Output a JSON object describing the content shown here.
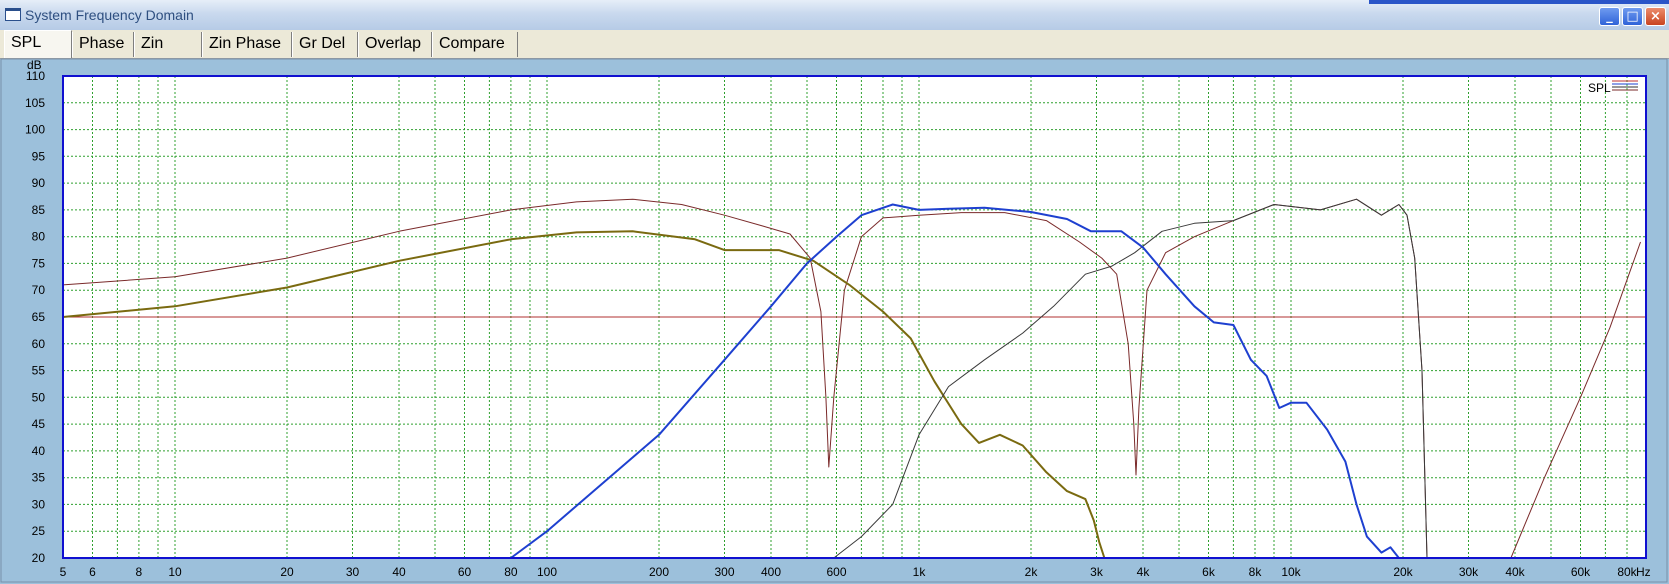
{
  "window": {
    "title": "System Frequency Domain",
    "min_icon": "minimize-icon",
    "max_icon": "maximize-icon",
    "close_icon": "close-icon"
  },
  "tabs": [
    {
      "label": "SPL",
      "active": true
    },
    {
      "label": "Phase",
      "active": false
    },
    {
      "label": "Zin",
      "active": false
    },
    {
      "label": "Zin Phase",
      "active": false
    },
    {
      "label": "Gr Del",
      "active": false
    },
    {
      "label": "Overlap",
      "active": false
    },
    {
      "label": "Compare",
      "active": false
    }
  ],
  "colors": {
    "plot_bg": "#ffffff",
    "frame": "#1010d0",
    "grid": "#2fa02f",
    "window_bg": "#9cc0db",
    "reference": "#c03030"
  },
  "chart_data": {
    "type": "line",
    "xscale": "log",
    "xlim": [
      5,
      90000
    ],
    "ylim": [
      20,
      110
    ],
    "ylabel": "dB",
    "xlabel": "Hz",
    "yticks": [
      20,
      25,
      30,
      35,
      40,
      45,
      50,
      55,
      60,
      65,
      70,
      75,
      80,
      85,
      90,
      95,
      100,
      105,
      110
    ],
    "xticks": [
      {
        "v": 5,
        "label": "5"
      },
      {
        "v": 6,
        "label": "6"
      },
      {
        "v": 8,
        "label": "8"
      },
      {
        "v": 10,
        "label": "10"
      },
      {
        "v": 20,
        "label": "20"
      },
      {
        "v": 30,
        "label": "30"
      },
      {
        "v": 40,
        "label": "40"
      },
      {
        "v": 60,
        "label": "60"
      },
      {
        "v": 80,
        "label": "80"
      },
      {
        "v": 100,
        "label": "100"
      },
      {
        "v": 200,
        "label": "200"
      },
      {
        "v": 300,
        "label": "300"
      },
      {
        "v": 400,
        "label": "400"
      },
      {
        "v": 600,
        "label": "600"
      },
      {
        "v": 1000,
        "label": "1k"
      },
      {
        "v": 2000,
        "label": "2k"
      },
      {
        "v": 3000,
        "label": "3k"
      },
      {
        "v": 4000,
        "label": "4k"
      },
      {
        "v": 6000,
        "label": "6k"
      },
      {
        "v": 8000,
        "label": "8k"
      },
      {
        "v": 10000,
        "label": "10k"
      },
      {
        "v": 20000,
        "label": "20k"
      },
      {
        "v": 30000,
        "label": "30k"
      },
      {
        "v": 40000,
        "label": "40k"
      },
      {
        "v": 60000,
        "label": "60k"
      },
      {
        "v": 80000,
        "label": "80k"
      }
    ],
    "grid": true,
    "legend": {
      "label": "SPL",
      "placement": "top-right",
      "colors": [
        "#c03030",
        "#1e40d0",
        "#303030",
        "#7a2a2a"
      ]
    },
    "series": [
      {
        "color": "#b03030",
        "width": 1,
        "points": [
          [
            5,
            65
          ],
          [
            90000,
            65
          ]
        ]
      },
      {
        "color": "#7a2a2a",
        "width": 1,
        "points": [
          [
            5,
            71
          ],
          [
            10,
            72.5
          ],
          [
            20,
            76
          ],
          [
            40,
            81
          ],
          [
            80,
            85
          ],
          [
            120,
            86.5
          ],
          [
            170,
            87
          ],
          [
            230,
            86
          ],
          [
            300,
            84
          ],
          [
            380,
            82
          ],
          [
            450,
            80.5
          ],
          [
            510,
            76
          ],
          [
            545,
            66
          ],
          [
            562,
            50
          ],
          [
            572,
            37
          ],
          [
            590,
            50
          ],
          [
            630,
            70
          ],
          [
            700,
            80
          ],
          [
            800,
            83.5
          ],
          [
            1000,
            84
          ],
          [
            1300,
            84.5
          ],
          [
            1700,
            84.5
          ],
          [
            2200,
            83
          ],
          [
            2700,
            79
          ],
          [
            3100,
            76
          ],
          [
            3400,
            73
          ],
          [
            3650,
            60
          ],
          [
            3780,
            45
          ],
          [
            3830,
            35.5
          ],
          [
            3900,
            48
          ],
          [
            4100,
            70
          ],
          [
            4600,
            77
          ],
          [
            5500,
            80
          ],
          [
            7000,
            83
          ],
          [
            9000,
            86
          ],
          [
            12000,
            85
          ],
          [
            15000,
            87
          ],
          [
            17500,
            84
          ],
          [
            19500,
            86
          ],
          [
            20500,
            84
          ],
          [
            21500,
            76
          ],
          [
            22500,
            55
          ],
          [
            23200,
            20
          ]
        ]
      },
      {
        "color": "#7a6a10",
        "width": 2,
        "points": [
          [
            5,
            65
          ],
          [
            10,
            67
          ],
          [
            20,
            70.5
          ],
          [
            40,
            75.5
          ],
          [
            80,
            79.5
          ],
          [
            120,
            80.8
          ],
          [
            170,
            81
          ],
          [
            250,
            79.5
          ],
          [
            300,
            77.5
          ],
          [
            420,
            77.5
          ],
          [
            520,
            75.5
          ],
          [
            650,
            71
          ],
          [
            800,
            66
          ],
          [
            950,
            61
          ],
          [
            1100,
            53
          ],
          [
            1300,
            45
          ],
          [
            1450,
            41.5
          ],
          [
            1650,
            43
          ],
          [
            1900,
            41
          ],
          [
            2200,
            36
          ],
          [
            2500,
            32.5
          ],
          [
            2800,
            31
          ],
          [
            2950,
            27
          ],
          [
            3050,
            23
          ],
          [
            3150,
            20
          ],
          [
            25000,
            20
          ]
        ]
      },
      {
        "color": "#3a3a3a",
        "width": 1,
        "points": [
          [
            590,
            20
          ],
          [
            700,
            24
          ],
          [
            850,
            30
          ],
          [
            1000,
            43
          ],
          [
            1200,
            52
          ],
          [
            1500,
            57
          ],
          [
            1900,
            62
          ],
          [
            2300,
            67
          ],
          [
            2800,
            73
          ],
          [
            3300,
            74.5
          ],
          [
            3800,
            77
          ],
          [
            4500,
            81
          ],
          [
            5500,
            82.5
          ],
          [
            7000,
            83
          ],
          [
            9000,
            86
          ],
          [
            12000,
            85
          ],
          [
            15000,
            87
          ],
          [
            17500,
            84
          ],
          [
            19500,
            86
          ],
          [
            20500,
            84
          ],
          [
            21500,
            76
          ],
          [
            22500,
            55
          ],
          [
            23200,
            20
          ]
        ]
      },
      {
        "color": "#1e40d0",
        "width": 2,
        "points": [
          [
            80,
            20
          ],
          [
            100,
            25
          ],
          [
            200,
            43
          ],
          [
            300,
            57
          ],
          [
            400,
            67
          ],
          [
            500,
            75
          ],
          [
            600,
            80
          ],
          [
            700,
            84
          ],
          [
            850,
            86
          ],
          [
            1000,
            85
          ],
          [
            1200,
            85.2
          ],
          [
            1500,
            85.4
          ],
          [
            2000,
            84.6
          ],
          [
            2500,
            83.3
          ],
          [
            2900,
            81
          ],
          [
            3500,
            81
          ],
          [
            4000,
            78
          ],
          [
            4600,
            73
          ],
          [
            5500,
            67
          ],
          [
            6200,
            64
          ],
          [
            7000,
            63.5
          ],
          [
            7800,
            57
          ],
          [
            8600,
            54
          ],
          [
            9300,
            48
          ],
          [
            10000,
            49
          ],
          [
            11000,
            49
          ],
          [
            12500,
            44
          ],
          [
            14000,
            38
          ],
          [
            15000,
            30
          ],
          [
            16000,
            24
          ],
          [
            17500,
            21
          ],
          [
            18500,
            22
          ],
          [
            19500,
            20
          ],
          [
            90000,
            20
          ]
        ]
      },
      {
        "color": "#7a2a2a",
        "width": 1,
        "points": [
          [
            39000,
            20
          ],
          [
            48000,
            35
          ],
          [
            60000,
            50
          ],
          [
            72000,
            63
          ],
          [
            87000,
            79
          ]
        ]
      }
    ]
  }
}
